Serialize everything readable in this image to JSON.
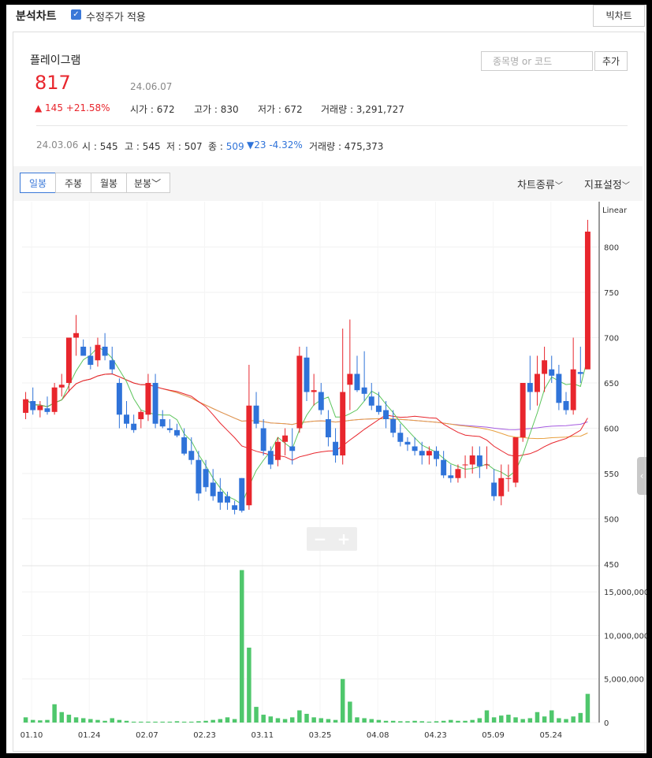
{
  "header": {
    "title": "분석차트",
    "adjusted_label": "수정주가 적용",
    "big_chart_label": "빅차트"
  },
  "stock": {
    "name": "플레이그램",
    "price": "817",
    "date": "24.06.07",
    "change": "▲ 145 +21.58%",
    "open_label": "시가",
    "open": "672",
    "high_label": "고가",
    "high": "830",
    "low_label": "저가",
    "low": "672",
    "volume_label": "거래량",
    "volume": "3,291,727"
  },
  "search": {
    "placeholder": "종목명 or 코드",
    "add_label": "추가"
  },
  "history": {
    "date": "24.03.06",
    "o_label": "시",
    "o": "545",
    "h_label": "고",
    "h": "545",
    "l_label": "저",
    "l": "507",
    "c_label": "종",
    "c": "509",
    "change": "▼23 -4.32%",
    "vol_label": "거래량",
    "vol": "475,373"
  },
  "toolbar": {
    "periods": [
      "일봉",
      "주봉",
      "월봉",
      "분봉"
    ],
    "active_period": "일봉",
    "chart_type_label": "차트종류",
    "indicator_label": "지표설정"
  },
  "colors": {
    "up": "#e8262d",
    "down": "#2f73d9",
    "volume": "#4fc76c",
    "ma5": "#5cc55c",
    "ma20": "#e8262d",
    "ma60": "#e8a040",
    "ma120": "#a55be0"
  },
  "chart_data": [
    {
      "type": "candlestick",
      "scale_label": "Linear",
      "ylim": [
        450,
        850
      ],
      "y_ticks": [
        500,
        550,
        600,
        650,
        700,
        750,
        800
      ],
      "y_tick_labels": [
        "450",
        "500",
        "550",
        "600",
        "650",
        "700",
        "750",
        "800"
      ],
      "x_labels": [
        "01.10",
        "01.24",
        "02.07",
        "02.23",
        "03.11",
        "03.25",
        "04.08",
        "04.23",
        "05.09",
        "05.24"
      ],
      "ohlc": [
        [
          617,
          640,
          610,
          632
        ],
        [
          630,
          645,
          615,
          620
        ],
        [
          620,
          630,
          612,
          625
        ],
        [
          622,
          635,
          615,
          618
        ],
        [
          618,
          650,
          615,
          645
        ],
        [
          645,
          660,
          635,
          648
        ],
        [
          650,
          690,
          640,
          700
        ],
        [
          700,
          725,
          680,
          705
        ],
        [
          690,
          698,
          680,
          680
        ],
        [
          680,
          690,
          665,
          670
        ],
        [
          675,
          700,
          668,
          692
        ],
        [
          690,
          705,
          675,
          680
        ],
        [
          675,
          690,
          660,
          665
        ],
        [
          650,
          655,
          600,
          615
        ],
        [
          615,
          630,
          600,
          605
        ],
        [
          605,
          615,
          595,
          598
        ],
        [
          610,
          620,
          600,
          618
        ],
        [
          615,
          660,
          608,
          650
        ],
        [
          650,
          660,
          600,
          605
        ],
        [
          610,
          620,
          600,
          602
        ],
        [
          600,
          610,
          595,
          598
        ],
        [
          598,
          605,
          590,
          592
        ],
        [
          590,
          600,
          570,
          572
        ],
        [
          575,
          590,
          560,
          565
        ],
        [
          565,
          575,
          520,
          528
        ],
        [
          555,
          565,
          530,
          535
        ],
        [
          540,
          555,
          520,
          525
        ],
        [
          530,
          545,
          510,
          518
        ],
        [
          525,
          530,
          510,
          518
        ],
        [
          515,
          520,
          505,
          510
        ],
        [
          545,
          545,
          507,
          509
        ],
        [
          515,
          670,
          510,
          625
        ],
        [
          625,
          640,
          600,
          605
        ],
        [
          600,
          610,
          570,
          575
        ],
        [
          575,
          580,
          555,
          560
        ],
        [
          565,
          590,
          558,
          585
        ],
        [
          585,
          600,
          570,
          592
        ],
        [
          580,
          600,
          560,
          575
        ],
        [
          600,
          690,
          595,
          680
        ],
        [
          678,
          690,
          630,
          640
        ],
        [
          640,
          660,
          625,
          642
        ],
        [
          640,
          650,
          615,
          620
        ],
        [
          610,
          620,
          580,
          590
        ],
        [
          585,
          600,
          562,
          570
        ],
        [
          570,
          710,
          560,
          640
        ],
        [
          648,
          720,
          620,
          660
        ],
        [
          660,
          680,
          640,
          642
        ],
        [
          645,
          685,
          630,
          638
        ],
        [
          635,
          650,
          620,
          625
        ],
        [
          625,
          640,
          615,
          618
        ],
        [
          620,
          630,
          600,
          610
        ],
        [
          610,
          620,
          590,
          595
        ],
        [
          595,
          605,
          580,
          585
        ],
        [
          585,
          590,
          575,
          582
        ],
        [
          580,
          590,
          570,
          575
        ],
        [
          575,
          585,
          560,
          570
        ],
        [
          570,
          580,
          560,
          575
        ],
        [
          575,
          580,
          558,
          566
        ],
        [
          565,
          575,
          545,
          548
        ],
        [
          548,
          560,
          540,
          545
        ],
        [
          545,
          560,
          540,
          555
        ],
        [
          560,
          570,
          545,
          560
        ],
        [
          560,
          580,
          550,
          570
        ],
        [
          570,
          580,
          545,
          558
        ],
        [
          560,
          580,
          555,
          560
        ],
        [
          540,
          555,
          520,
          525
        ],
        [
          525,
          560,
          515,
          545
        ],
        [
          545,
          560,
          530,
          545
        ],
        [
          540,
          590,
          535,
          590
        ],
        [
          590,
          650,
          585,
          650
        ],
        [
          650,
          680,
          620,
          640
        ],
        [
          640,
          680,
          625,
          660
        ],
        [
          660,
          690,
          640,
          675
        ],
        [
          665,
          680,
          650,
          658
        ],
        [
          660,
          670,
          620,
          628
        ],
        [
          630,
          640,
          615,
          620
        ],
        [
          620,
          700,
          615,
          665
        ],
        [
          662,
          690,
          650,
          660
        ],
        [
          665,
          830,
          672,
          817
        ]
      ],
      "volume": {
        "ylim": [
          0,
          18000000
        ],
        "y_ticks": [
          0,
          5000000,
          10000000,
          15000000
        ],
        "y_tick_labels": [
          "0",
          "5,000,000",
          "10,000,000",
          "15,000,000"
        ],
        "values": [
          600000,
          300000,
          250000,
          300000,
          2100000,
          1200000,
          900000,
          600000,
          500000,
          400000,
          300000,
          200000,
          500000,
          300000,
          200000,
          100000,
          100000,
          100000,
          100000,
          100000,
          100000,
          150000,
          100000,
          100000,
          150000,
          200000,
          300000,
          400000,
          600000,
          400000,
          17500000,
          8600000,
          1800000,
          900000,
          700000,
          500000,
          400000,
          600000,
          1400000,
          1000000,
          600000,
          500000,
          400000,
          300000,
          5000000,
          2400000,
          600000,
          500000,
          400000,
          300000,
          200000,
          200000,
          150000,
          150000,
          200000,
          150000,
          100000,
          150000,
          200000,
          300000,
          200000,
          200000,
          300000,
          500000,
          1400000,
          600000,
          800000,
          900000,
          600000,
          400000,
          500000,
          1200000,
          700000,
          1400000,
          500000,
          400000,
          700000,
          1100000,
          3291727
        ]
      }
    }
  ]
}
